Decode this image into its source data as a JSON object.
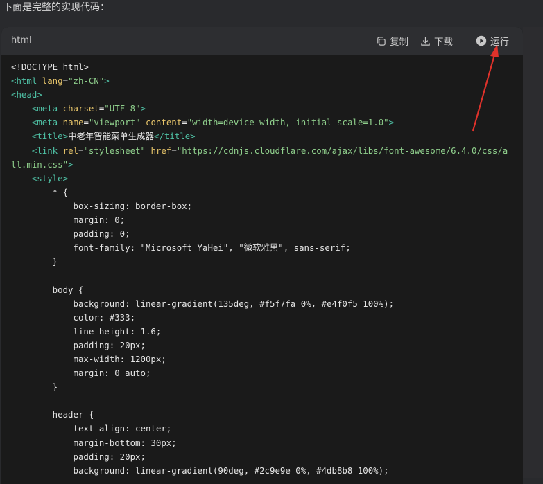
{
  "intro_text": "下面是完整的实现代码：",
  "code_block": {
    "language": "html",
    "actions": {
      "copy_label": "复制",
      "download_label": "下载",
      "run_label": "运行"
    },
    "icons": {
      "copy": "copy-icon",
      "download": "download-icon",
      "run": "play-circle-icon"
    }
  },
  "colors": {
    "tag": "#4fc1a5",
    "attribute": "#e6c46a",
    "string": "#8fcf8c",
    "annotation_arrow": "#e0322b"
  },
  "code_lines": [
    [
      [
        "txt",
        "<!DOCTYPE html>"
      ]
    ],
    [
      [
        "tag",
        "<html "
      ],
      [
        "attr",
        "lang"
      ],
      [
        "txt",
        "="
      ],
      [
        "str",
        "\"zh-CN\""
      ],
      [
        "tag",
        ">"
      ]
    ],
    [
      [
        "tag",
        "<head>"
      ]
    ],
    [
      [
        "txt",
        "    "
      ],
      [
        "tag",
        "<meta "
      ],
      [
        "attr",
        "charset"
      ],
      [
        "txt",
        "="
      ],
      [
        "str",
        "\"UTF-8\""
      ],
      [
        "tag",
        ">"
      ]
    ],
    [
      [
        "txt",
        "    "
      ],
      [
        "tag",
        "<meta "
      ],
      [
        "attr",
        "name"
      ],
      [
        "txt",
        "="
      ],
      [
        "str",
        "\"viewport\""
      ],
      [
        "txt",
        " "
      ],
      [
        "attr",
        "content"
      ],
      [
        "txt",
        "="
      ],
      [
        "str",
        "\"width=device-width, initial-scale=1.0\""
      ],
      [
        "tag",
        ">"
      ]
    ],
    [
      [
        "txt",
        "    "
      ],
      [
        "tag",
        "<title>"
      ],
      [
        "txt",
        "中老年智能菜单生成器"
      ],
      [
        "tag",
        "</title>"
      ]
    ],
    [
      [
        "txt",
        "    "
      ],
      [
        "tag",
        "<link "
      ],
      [
        "attr",
        "rel"
      ],
      [
        "txt",
        "="
      ],
      [
        "str",
        "\"stylesheet\""
      ],
      [
        "txt",
        " "
      ],
      [
        "attr",
        "href"
      ],
      [
        "txt",
        "="
      ],
      [
        "str",
        "\"https://cdnjs.cloudflare.com/ajax/libs/font-awesome/6.4.0/css/a"
      ]
    ],
    [
      [
        "str",
        "ll.min.css\""
      ],
      [
        "tag",
        ">"
      ]
    ],
    [
      [
        "txt",
        "    "
      ],
      [
        "tag",
        "<style>"
      ]
    ],
    [
      [
        "txt",
        "        * {"
      ]
    ],
    [
      [
        "txt",
        "            box-sizing: border-box;"
      ]
    ],
    [
      [
        "txt",
        "            margin: 0;"
      ]
    ],
    [
      [
        "txt",
        "            padding: 0;"
      ]
    ],
    [
      [
        "txt",
        "            font-family: \"Microsoft YaHei\", \"微软雅黑\", sans-serif;"
      ]
    ],
    [
      [
        "txt",
        "        }"
      ]
    ],
    [
      [
        "txt",
        ""
      ]
    ],
    [
      [
        "txt",
        "        body {"
      ]
    ],
    [
      [
        "txt",
        "            background: linear-gradient(135deg, #f5f7fa 0%, #e4f0f5 100%);"
      ]
    ],
    [
      [
        "txt",
        "            color: #333;"
      ]
    ],
    [
      [
        "txt",
        "            line-height: 1.6;"
      ]
    ],
    [
      [
        "txt",
        "            padding: 20px;"
      ]
    ],
    [
      [
        "txt",
        "            max-width: 1200px;"
      ]
    ],
    [
      [
        "txt",
        "            margin: 0 auto;"
      ]
    ],
    [
      [
        "txt",
        "        }"
      ]
    ],
    [
      [
        "txt",
        ""
      ]
    ],
    [
      [
        "txt",
        "        header {"
      ]
    ],
    [
      [
        "txt",
        "            text-align: center;"
      ]
    ],
    [
      [
        "txt",
        "            margin-bottom: 30px;"
      ]
    ],
    [
      [
        "txt",
        "            padding: 20px;"
      ]
    ],
    [
      [
        "txt",
        "            background: linear-gradient(90deg, #2c9e9e 0%, #4db8b8 100%);"
      ]
    ]
  ]
}
